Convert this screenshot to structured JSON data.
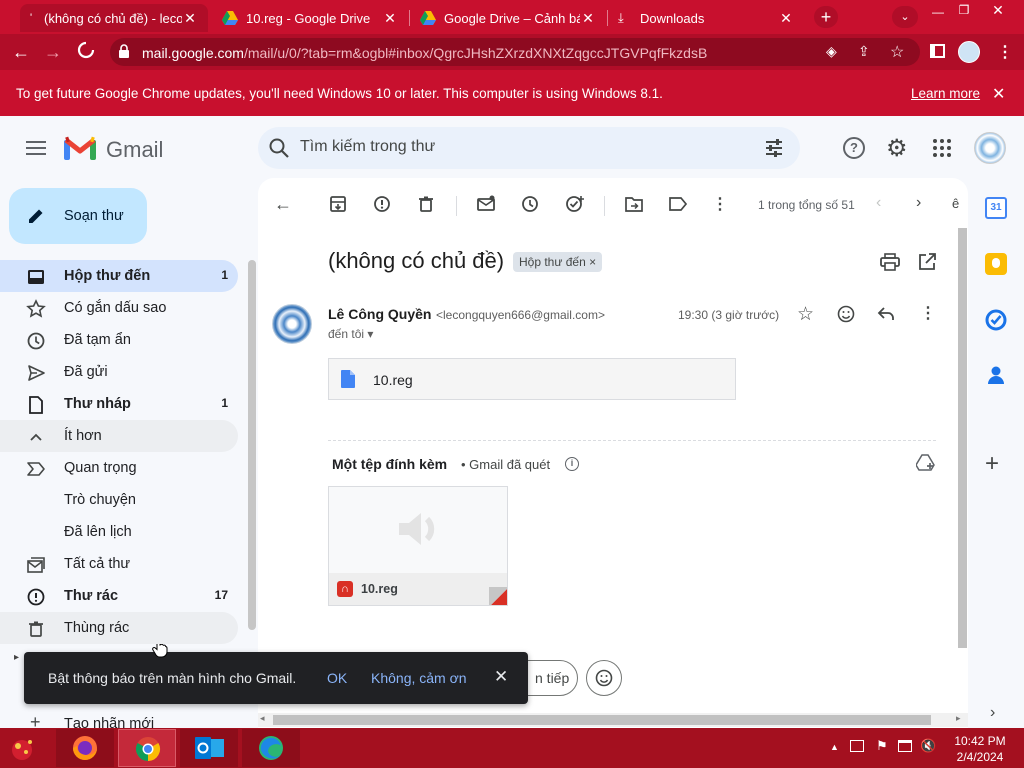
{
  "browser": {
    "tabs": [
      {
        "title": "(không có chủ đề) - lecon",
        "active": true
      },
      {
        "title": "10.reg - Google Drive",
        "active": false
      },
      {
        "title": "Google Drive – Cảnh báo",
        "active": false
      },
      {
        "title": "Downloads",
        "active": false
      }
    ],
    "url_host": "mail.google.com",
    "url_path": "/mail/u/0/?tab=rm&ogbl#inbox/QgrcJHshZXrzdXNXtZqgccJTGVPqfFkzdsB",
    "infobar_text": "To get future Google Chrome updates, you'll need Windows 10 or later. This computer is using Windows 8.1.",
    "infobar_link": "Learn more"
  },
  "gmail": {
    "logo_text": "Gmail",
    "search_placeholder": "Tìm kiếm trong thư",
    "compose_label": "Soạn thư",
    "nav": [
      {
        "label": "Hộp thư đến",
        "count": "1",
        "bold": true,
        "selected": true,
        "icon": "inbox-icon"
      },
      {
        "label": "Có gắn dấu sao",
        "count": "",
        "icon": "star-icon"
      },
      {
        "label": "Đã tạm ẩn",
        "count": "",
        "icon": "clock-icon"
      },
      {
        "label": "Đã gửi",
        "count": "",
        "icon": "send-icon"
      },
      {
        "label": "Thư nháp",
        "count": "1",
        "bold": true,
        "icon": "draft-icon"
      },
      {
        "label": "Ít hơn",
        "count": "",
        "icon": "chevron-up-icon"
      },
      {
        "label": "Quan trọng",
        "count": "",
        "icon": "important-icon"
      },
      {
        "label": "Trò chuyện",
        "count": "",
        "icon": ""
      },
      {
        "label": "Đã lên lịch",
        "count": "",
        "icon": ""
      },
      {
        "label": "Tất cả thư",
        "count": "",
        "icon": "all-mail-icon"
      },
      {
        "label": "Thư rác",
        "count": "17",
        "bold": true,
        "icon": "spam-icon"
      },
      {
        "label": "Thùng rác",
        "count": "",
        "icon": "trash-icon"
      }
    ],
    "create_label": "Tạo nhãn mới",
    "pagination": "1 trong tổng số 51",
    "subject": "(không có chủ đề)",
    "label_chip": "Hộp thư đến",
    "sender_name": "Lê Công Quyền",
    "sender_email": "<lecongquyen666@gmail.com>",
    "recipient": "đến tôi",
    "time": "19:30 (3 giờ trước)",
    "attachment_inline": "10.reg",
    "attachments_header": "Một tệp đính kèm",
    "scanned_text": "• Gmail đã quét",
    "attachment_card_name": "10.reg",
    "forward_partial": "n tiếp",
    "toast_text": "Bật thông báo trên màn hình cho Gmail.",
    "toast_ok": "OK",
    "toast_no": "Không, cảm ơn"
  },
  "taskbar": {
    "time": "10:42 PM",
    "date": "2/4/2024"
  },
  "colors": {
    "chrome_red": "#c8102e",
    "gmail_blue": "#0b57d0",
    "nav_selected": "#d3e3fd",
    "compose_bg": "#c2e7ff"
  }
}
